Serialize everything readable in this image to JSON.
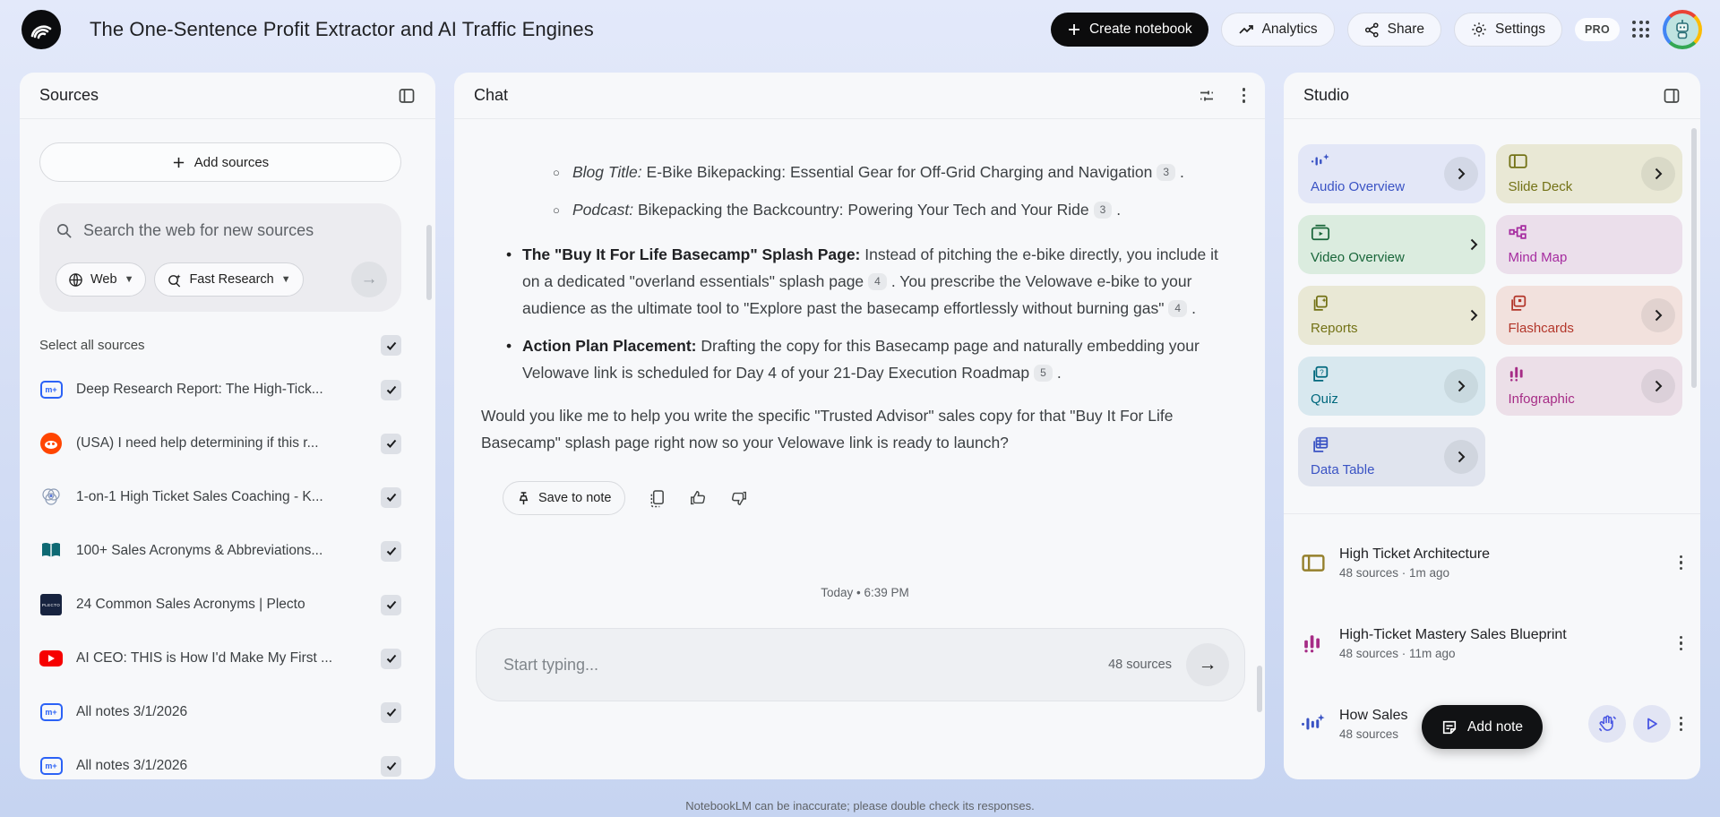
{
  "header": {
    "title": "The One-Sentence Profit Extractor and AI Traffic Engines",
    "create_notebook": "Create notebook",
    "analytics": "Analytics",
    "share": "Share",
    "settings": "Settings",
    "pro": "PRO"
  },
  "sources": {
    "header": "Sources",
    "add_button": "Add sources",
    "search_placeholder": "Search the web for new sources",
    "web_chip": "Web",
    "research_chip": "Fast Research",
    "select_all": "Select all sources",
    "items": [
      {
        "title": "Deep Research Report: The High-Tick...",
        "icon": "notebook-doc",
        "icon_text": "m+"
      },
      {
        "title": "(USA) I need help determining if this r...",
        "icon": "reddit"
      },
      {
        "title": "1-on-1 High Ticket Sales Coaching - K...",
        "icon": "venn"
      },
      {
        "title": "100+ Sales Acronyms & Abbreviations...",
        "icon": "book"
      },
      {
        "title": "24 Common Sales Acronyms | Plecto",
        "icon": "plecto",
        "icon_text": "PLECTO"
      },
      {
        "title": "AI CEO: THIS is How I'd Make My First ...",
        "icon": "youtube"
      },
      {
        "title": "All notes 3/1/2026",
        "icon": "notebook-doc",
        "icon_text": "m+"
      },
      {
        "title": "All notes 3/1/2026",
        "icon": "notebook-doc",
        "icon_text": "m+"
      }
    ]
  },
  "chat": {
    "header": "Chat",
    "sub1_label": "Blog Title:",
    "sub1_text": " E-Bike Bikepacking: Essential Gear for Off-Grid Charging and Navigation",
    "sub1_cite": "3",
    "sub1_end": ".",
    "sub2_label": "Podcast:",
    "sub2_text": " Bikepacking the Backcountry: Powering Your Tech and Your Ride",
    "sub2_cite": "3",
    "sub2_end": ".",
    "m1_label": "The \"Buy It For Life Basecamp\" Splash Page:",
    "m1_t1": " Instead of pitching the e-bike directly, you include it on a dedicated \"overland essentials\" splash page",
    "m1_c1": "4",
    "m1_t2": ". You prescribe the Velowave e-bike to your audience as the ultimate tool to \"Explore past the basecamp effortlessly without burning gas\"",
    "m1_c2": "4",
    "m1_end": ".",
    "m2_label": "Action Plan Placement:",
    "m2_t1": " Drafting the copy for this Basecamp page and naturally embedding your Velowave link is scheduled for Day 4 of your 21-Day Execution Roadmap",
    "m2_c1": "5",
    "m2_end": ".",
    "closing": "Would you like me to help you write the specific \"Trusted Advisor\" sales copy for that \"Buy It For Life Basecamp\" splash page right now so your Velowave link is ready to launch?",
    "save_to_note": "Save to note",
    "timestamp": "Today • 6:39 PM",
    "input_placeholder": "Start typing...",
    "sources_count": "48 sources",
    "disclaimer": "NotebookLM can be inaccurate; please double check its responses."
  },
  "studio": {
    "header": "Studio",
    "cards": [
      {
        "label": "Audio Overview"
      },
      {
        "label": "Slide Deck"
      },
      {
        "label": "Video Overview"
      },
      {
        "label": "Mind Map"
      },
      {
        "label": "Reports"
      },
      {
        "label": "Flashcards"
      },
      {
        "label": "Quiz"
      },
      {
        "label": "Infographic"
      },
      {
        "label": "Data Table"
      }
    ],
    "notes": [
      {
        "title": "High Ticket Architecture",
        "meta": "48 sources · 1m ago"
      },
      {
        "title": "High-Ticket Mastery Sales Blueprint",
        "meta": "48 sources · 11m ago"
      },
      {
        "title": "How Sales",
        "meta": "48 sources"
      }
    ],
    "add_note": "Add note"
  },
  "colors": {
    "audio_accent": "#3a53c4",
    "slide_accent": "#737216",
    "video_accent": "#19663a",
    "mind_accent": "#a62ca0",
    "flash_accent": "#b3362a",
    "quiz_accent": "#00687d",
    "info_accent": "#a62c86",
    "data_accent": "#3a53c4",
    "youtube_red": "#f60000",
    "reddit_orange": "#ff4500",
    "source_blue": "#2b62f6"
  }
}
